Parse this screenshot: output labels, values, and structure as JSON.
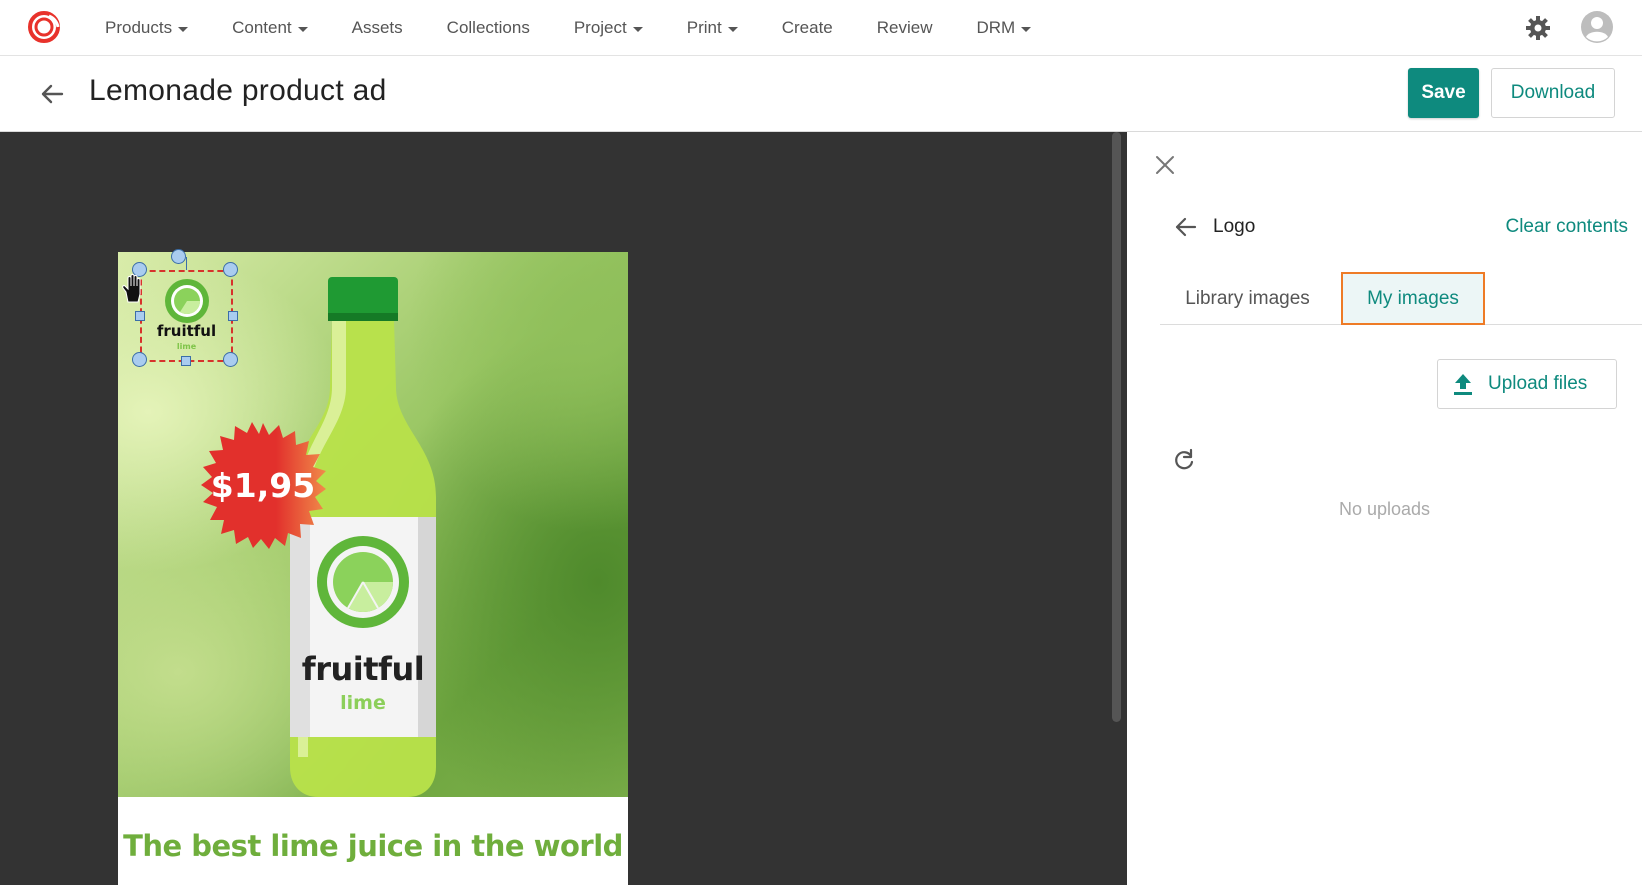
{
  "nav": {
    "items": [
      {
        "label": "Products",
        "has_caret": true
      },
      {
        "label": "Content",
        "has_caret": true
      },
      {
        "label": "Assets",
        "has_caret": false
      },
      {
        "label": "Collections",
        "has_caret": false
      },
      {
        "label": "Project",
        "has_caret": true
      },
      {
        "label": "Print",
        "has_caret": true
      },
      {
        "label": "Create",
        "has_caret": false
      },
      {
        "label": "Review",
        "has_caret": false
      },
      {
        "label": "DRM",
        "has_caret": true
      }
    ],
    "icons": {
      "brand": "brand-logo-icon",
      "settings": "gear-icon",
      "user": "avatar-icon"
    }
  },
  "header": {
    "title": "Lemonade product ad",
    "save_label": "Save",
    "download_label": "Download"
  },
  "ad": {
    "price": "$1,95",
    "bottle_brand": "fruitful",
    "bottle_sub": "lime",
    "logo_word": "fruitful",
    "logo_sub": "lime",
    "slogan": "The best lime juice in the world"
  },
  "panel": {
    "title": "Logo",
    "clear_label": "Clear contents",
    "tabs": [
      {
        "label": "Library images",
        "active": false
      },
      {
        "label": "My images",
        "active": true
      }
    ],
    "upload_label": "Upload files",
    "empty_text": "No uploads"
  },
  "colors": {
    "accent": "#0e8a7e",
    "canvas_bg": "#333333",
    "tab_highlight_border": "#ee7b26",
    "slogan": "#6fae3c",
    "price_badge": "#e2302c"
  }
}
